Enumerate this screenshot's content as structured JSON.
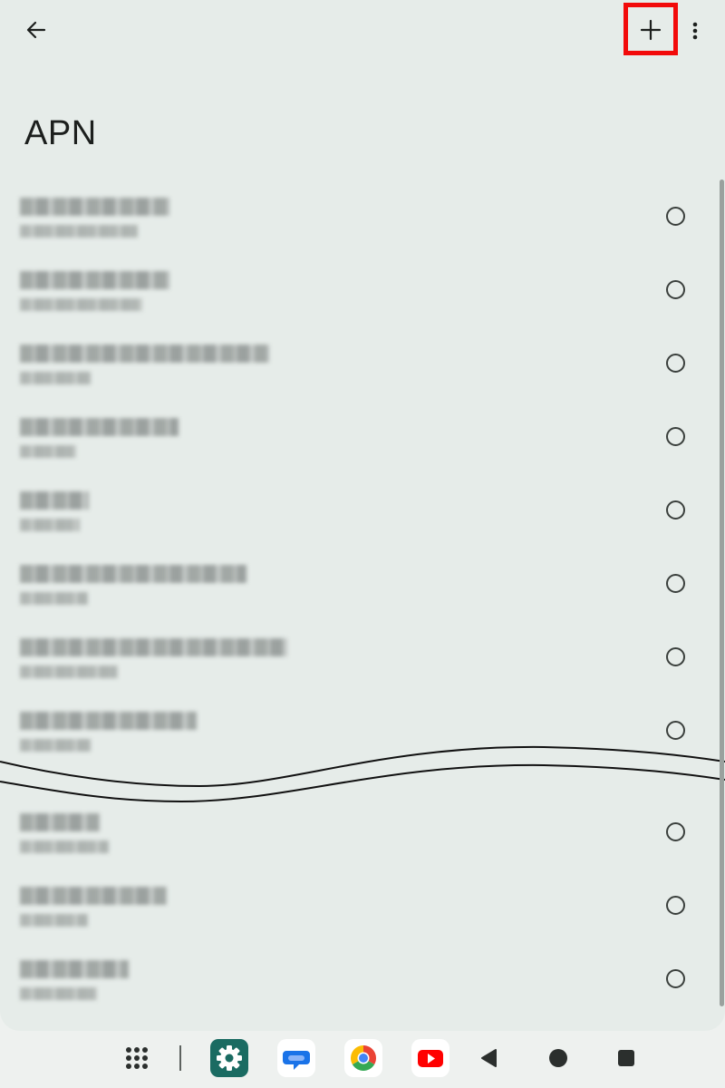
{
  "header": {
    "title": "APN",
    "back_icon": "arrow-back-icon",
    "add_icon": "add-icon",
    "more_icon": "more-vert-icon",
    "highlight_color": "#f20a0a"
  },
  "apn_list": {
    "selection_icon": "radio-unchecked-icon",
    "content_obscured": true,
    "break_marker": "wavy-break"
  },
  "taskbar": {
    "items": [
      "app-drawer-icon",
      "settings-app-icon",
      "messages-app-icon",
      "chrome-app-icon",
      "youtube-app-icon",
      "back-nav-icon",
      "home-nav-icon",
      "recents-nav-icon"
    ]
  }
}
